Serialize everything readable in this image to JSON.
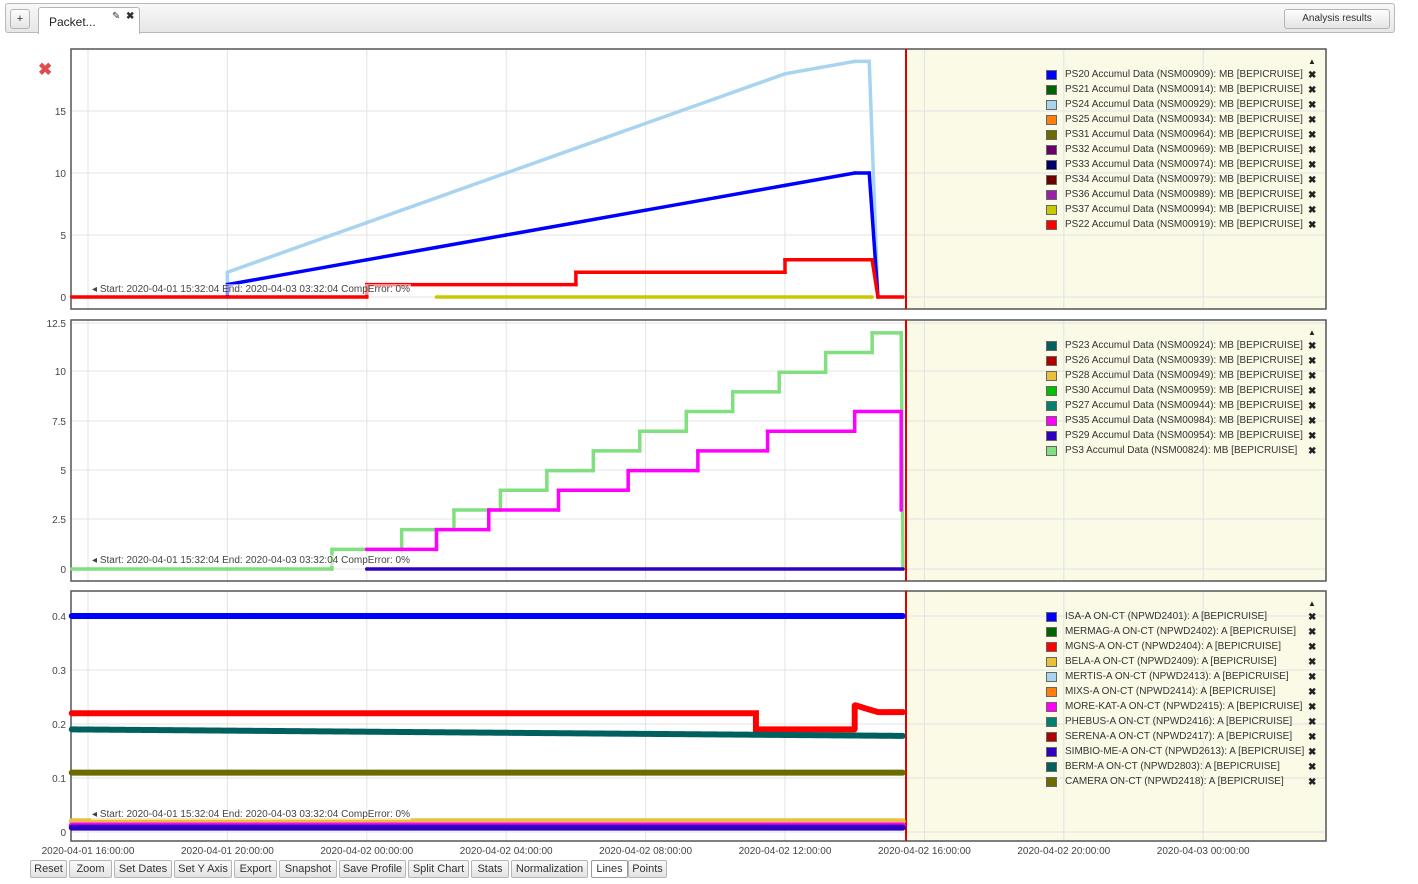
{
  "topbar": {
    "add_label": "+",
    "tab_label": "Packet...",
    "analysis_label": "Analysis results"
  },
  "xaxis_ticks": [
    "2020-04-01 16:00:00",
    "2020-04-01 20:00:00",
    "2020-04-02 00:00:00",
    "2020-04-02 04:00:00",
    "2020-04-02 08:00:00",
    "2020-04-02 12:00:00",
    "2020-04-02 16:00:00",
    "2020-04-02 20:00:00",
    "2020-04-03 00:00:00"
  ],
  "toolbar": {
    "buttons": [
      "Reset",
      "Zoom",
      "Set Dates",
      "Set Y Axis",
      "Export",
      "Snapshot",
      "Save Profile",
      "Split Chart",
      "Stats",
      "Normalization",
      "Lines",
      "Points"
    ]
  },
  "panels": [
    {
      "status": "Start: 2020-04-01 15:32:04 End: 2020-04-03 03:32:04 CompError: 0%",
      "yticks": [
        "0",
        "5",
        "10",
        "15"
      ],
      "legend": [
        {
          "label": "PS20 Accumul Data (NSM00909): MB [BEPICRUISE]",
          "color": "#0000ff"
        },
        {
          "label": "PS21 Accumul Data (NSM00914): MB [BEPICRUISE]",
          "color": "#006400"
        },
        {
          "label": "PS24 Accumul Data (NSM00929): MB [BEPICRUISE]",
          "color": "#a8d4f0"
        },
        {
          "label": "PS25 Accumul Data (NSM00934): MB [BEPICRUISE]",
          "color": "#ff7f0e"
        },
        {
          "label": "PS31 Accumul Data (NSM00964): MB [BEPICRUISE]",
          "color": "#6b6b00"
        },
        {
          "label": "PS32 Accumul Data (NSM00969): MB [BEPICRUISE]",
          "color": "#6b006b"
        },
        {
          "label": "PS33 Accumul Data (NSM00974): MB [BEPICRUISE]",
          "color": "#00006b"
        },
        {
          "label": "PS34 Accumul Data (NSM00979): MB [BEPICRUISE]",
          "color": "#6b0000"
        },
        {
          "label": "PS36 Accumul Data (NSM00989): MB [BEPICRUISE]",
          "color": "#9b1fa8"
        },
        {
          "label": "PS37 Accumul Data (NSM00994): MB [BEPICRUISE]",
          "color": "#c8c800"
        },
        {
          "label": "PS22 Accumul Data (NSM00919): MB [BEPICRUISE]",
          "color": "#ff0000"
        }
      ]
    },
    {
      "status": "Start: 2020-04-01 15:32:04 End: 2020-04-03 03:32:04 CompError: 0%",
      "yticks": [
        "0",
        "2.5",
        "5",
        "7.5",
        "10",
        "12.5"
      ],
      "legend": [
        {
          "label": "PS23 Accumul Data (NSM00924): MB [BEPICRUISE]",
          "color": "#006060"
        },
        {
          "label": "PS26 Accumul Data (NSM00939): MB [BEPICRUISE]",
          "color": "#b00000"
        },
        {
          "label": "PS28 Accumul Data (NSM00949): MB [BEPICRUISE]",
          "color": "#e8c040"
        },
        {
          "label": "PS30 Accumul Data (NSM00959): MB [BEPICRUISE]",
          "color": "#00c000"
        },
        {
          "label": "PS27 Accumul Data (NSM00944): MB [BEPICRUISE]",
          "color": "#008070"
        },
        {
          "label": "PS35 Accumul Data (NSM00984): MB [BEPICRUISE]",
          "color": "#ff00ff"
        },
        {
          "label": "PS29 Accumul Data (NSM00954): MB [BEPICRUISE]",
          "color": "#3000c0"
        },
        {
          "label": "PS3 Accumul Data (NSM00824): MB [BEPICRUISE]",
          "color": "#80e080"
        }
      ]
    },
    {
      "status": "Start: 2020-04-01 15:32:04 End: 2020-04-03 03:32:04 CompError: 0%",
      "yticks": [
        "0",
        "0.1",
        "0.2",
        "0.3",
        "0.4"
      ],
      "legend": [
        {
          "label": "ISA-A ON-CT (NPWD2401): A [BEPICRUISE]",
          "color": "#0000ff"
        },
        {
          "label": "MERMAG-A ON-CT (NPWD2402): A [BEPICRUISE]",
          "color": "#006400"
        },
        {
          "label": "MGNS-A ON-CT (NPWD2404): A [BEPICRUISE]",
          "color": "#ff0000"
        },
        {
          "label": "BELA-A ON-CT (NPWD2409): A [BEPICRUISE]",
          "color": "#e8c040"
        },
        {
          "label": "MERTIS-A ON-CT (NPWD2413): A [BEPICRUISE]",
          "color": "#a8d4f0"
        },
        {
          "label": "MIXS-A ON-CT (NPWD2414): A [BEPICRUISE]",
          "color": "#ff7f0e"
        },
        {
          "label": "MORE-KAT-A ON-CT (NPWD2415): A [BEPICRUISE]",
          "color": "#ff00ff"
        },
        {
          "label": "PHEBUS-A ON-CT (NPWD2416): A [BEPICRUISE]",
          "color": "#008070"
        },
        {
          "label": "SERENA-A ON-CT (NPWD2417): A [BEPICRUISE]",
          "color": "#b00000"
        },
        {
          "label": "SIMBIO-ME-A ON-CT (NPWD2613): A [BEPICRUISE]",
          "color": "#3000c0"
        },
        {
          "label": "BERM-A ON-CT (NPWD2803): A [BEPICRUISE]",
          "color": "#006060"
        },
        {
          "label": "CAMERA ON-CT (NPWD2418): A [BEPICRUISE]",
          "color": "#6b6b00"
        }
      ]
    }
  ],
  "chart_data": [
    {
      "type": "line",
      "ylim": [
        0,
        19
      ],
      "series": [
        {
          "name": "PS24 Accumul Data (NSM00929): MB [BEPICRUISE]",
          "color": "#a8d4f0",
          "points": [
            [
              "2020-04-01 20:00",
              0
            ],
            [
              "2020-04-01 20:00",
              2
            ],
            [
              "2020-04-01 21:00",
              3
            ],
            [
              "2020-04-01 22:00",
              4
            ],
            [
              "2020-04-01 23:00",
              5
            ],
            [
              "2020-04-02 00:00",
              6
            ],
            [
              "2020-04-02 01:00",
              7
            ],
            [
              "2020-04-02 02:00",
              8
            ],
            [
              "2020-04-02 03:00",
              9
            ],
            [
              "2020-04-02 04:00",
              10
            ],
            [
              "2020-04-02 05:00",
              11
            ],
            [
              "2020-04-02 06:00",
              12
            ],
            [
              "2020-04-02 07:00",
              13
            ],
            [
              "2020-04-02 08:00",
              14
            ],
            [
              "2020-04-02 09:00",
              15
            ],
            [
              "2020-04-02 10:00",
              16
            ],
            [
              "2020-04-02 11:00",
              17
            ],
            [
              "2020-04-02 12:00",
              18
            ],
            [
              "2020-04-02 14:00",
              19
            ],
            [
              "2020-04-02 14:25",
              19
            ],
            [
              "2020-04-02 14:40",
              0
            ]
          ]
        },
        {
          "name": "PS20 Accumul Data (NSM00909): MB [BEPICRUISE]",
          "color": "#0000ff",
          "points": [
            [
              "2020-04-01 20:00",
              0
            ],
            [
              "2020-04-01 20:00",
              1
            ],
            [
              "2020-04-01 22:00",
              2
            ],
            [
              "2020-04-02 00:00",
              3
            ],
            [
              "2020-04-02 02:00",
              4
            ],
            [
              "2020-04-02 04:00",
              5
            ],
            [
              "2020-04-02 06:00",
              6
            ],
            [
              "2020-04-02 08:00",
              7
            ],
            [
              "2020-04-02 10:00",
              8
            ],
            [
              "2020-04-02 12:00",
              9
            ],
            [
              "2020-04-02 14:00",
              10
            ],
            [
              "2020-04-02 14:25",
              10
            ],
            [
              "2020-04-02 14:40",
              0
            ]
          ]
        },
        {
          "name": "PS22 Accumul Data (NSM00919): MB [BEPICRUISE]",
          "color": "#ff0000",
          "points": [
            [
              "2020-04-01 15:32",
              0
            ],
            [
              "2020-04-02 00:00",
              0
            ],
            [
              "2020-04-02 00:00",
              1
            ],
            [
              "2020-04-02 06:00",
              1
            ],
            [
              "2020-04-02 06:00",
              2
            ],
            [
              "2020-04-02 12:00",
              2
            ],
            [
              "2020-04-02 12:00",
              3
            ],
            [
              "2020-04-02 14:30",
              3
            ],
            [
              "2020-04-02 14:40",
              0
            ],
            [
              "2020-04-02 16:00",
              0
            ]
          ]
        },
        {
          "name": "PS37 Accumul Data (NSM00994): MB [BEPICRUISE]",
          "color": "#c8c800",
          "points": [
            [
              "2020-04-02 02:00",
              0
            ],
            [
              "2020-04-02 14:30",
              0
            ]
          ]
        }
      ]
    },
    {
      "type": "line",
      "ylim": [
        0,
        12.5
      ],
      "series": [
        {
          "name": "PS3 Accumul Data (NSM00824): MB [BEPICRUISE]",
          "color": "#80e080",
          "points": [
            [
              "2020-04-01 15:32",
              0
            ],
            [
              "2020-04-01 23:00",
              0
            ],
            [
              "2020-04-01 23:00",
              1
            ],
            [
              "2020-04-02 01:00",
              1
            ],
            [
              "2020-04-02 01:00",
              2
            ],
            [
              "2020-04-02 02:30",
              2
            ],
            [
              "2020-04-02 02:30",
              3
            ],
            [
              "2020-04-02 03:50",
              3
            ],
            [
              "2020-04-02 03:50",
              4
            ],
            [
              "2020-04-02 05:10",
              4
            ],
            [
              "2020-04-02 05:10",
              5
            ],
            [
              "2020-04-02 06:30",
              5
            ],
            [
              "2020-04-02 06:30",
              6
            ],
            [
              "2020-04-02 07:50",
              6
            ],
            [
              "2020-04-02 07:50",
              7
            ],
            [
              "2020-04-02 09:10",
              7
            ],
            [
              "2020-04-02 09:10",
              8
            ],
            [
              "2020-04-02 10:30",
              8
            ],
            [
              "2020-04-02 10:30",
              9
            ],
            [
              "2020-04-02 11:50",
              9
            ],
            [
              "2020-04-02 11:50",
              10
            ],
            [
              "2020-04-02 13:10",
              10
            ],
            [
              "2020-04-02 13:10",
              11
            ],
            [
              "2020-04-02 14:30",
              11
            ],
            [
              "2020-04-02 14:30",
              12
            ],
            [
              "2020-04-02 15:20",
              12
            ],
            [
              "2020-04-02 15:30",
              0
            ],
            [
              "2020-04-02 16:00",
              0
            ]
          ]
        },
        {
          "name": "PS35 Accumul Data (NSM00984): MB [BEPICRUISE]",
          "color": "#ff00ff",
          "points": [
            [
              "2020-04-02 00:00",
              1
            ],
            [
              "2020-04-02 02:00",
              1
            ],
            [
              "2020-04-02 02:00",
              2
            ],
            [
              "2020-04-02 03:30",
              2
            ],
            [
              "2020-04-02 03:30",
              3
            ],
            [
              "2020-04-02 05:30",
              3
            ],
            [
              "2020-04-02 05:30",
              4
            ],
            [
              "2020-04-02 07:30",
              4
            ],
            [
              "2020-04-02 07:30",
              5
            ],
            [
              "2020-04-02 09:30",
              5
            ],
            [
              "2020-04-02 09:30",
              6
            ],
            [
              "2020-04-02 11:30",
              6
            ],
            [
              "2020-04-02 11:30",
              7
            ],
            [
              "2020-04-02 14:00",
              7
            ],
            [
              "2020-04-02 14:00",
              8
            ],
            [
              "2020-04-02 15:20",
              8
            ],
            [
              "2020-04-02 15:20",
              3
            ]
          ]
        },
        {
          "name": "PS29 Accumul Data (NSM00954): MB [BEPICRUISE]",
          "color": "#3000c0",
          "points": [
            [
              "2020-04-02 00:00",
              0
            ],
            [
              "2020-04-02 15:30",
              0
            ]
          ]
        }
      ]
    },
    {
      "type": "scatter",
      "ylim": [
        0,
        0.4
      ],
      "series": [
        {
          "name": "ISA-A ON-CT (NPWD2401): A [BEPICRUISE]",
          "color": "#0000ff",
          "points": [
            [
              "2020-04-01 15:32",
              0.4
            ],
            [
              "2020-04-02 15:30",
              0.4
            ]
          ]
        },
        {
          "name": "MGNS-A ON-CT (NPWD2404): A [BEPICRUISE]",
          "color": "#ff0000",
          "points": [
            [
              "2020-04-01 15:32",
              0.22
            ],
            [
              "2020-04-02 11:10",
              0.22
            ],
            [
              "2020-04-02 11:10",
              0.19
            ],
            [
              "2020-04-02 14:00",
              0.19
            ],
            [
              "2020-04-02 14:00",
              0.235
            ],
            [
              "2020-04-02 14:40",
              0.222
            ],
            [
              "2020-04-02 15:30",
              0.222
            ]
          ]
        },
        {
          "name": "BERM-A ON-CT (NPWD2803): A [BEPICRUISE]",
          "color": "#006060",
          "points": [
            [
              "2020-04-01 15:32",
              0.19
            ],
            [
              "2020-04-02 15:30",
              0.178
            ]
          ]
        },
        {
          "name": "CAMERA ON-CT (NPWD2418): A [BEPICRUISE]",
          "color": "#6b6b00",
          "points": [
            [
              "2020-04-01 15:32",
              0.11
            ],
            [
              "2020-04-02 15:30",
              0.11
            ]
          ]
        },
        {
          "name": "BELA-A ON-CT (NPWD2409): A [BEPICRUISE]",
          "color": "#e8c040",
          "points": [
            [
              "2020-04-01 15:32",
              0.02
            ],
            [
              "2020-04-02 15:30",
              0.02
            ]
          ]
        },
        {
          "name": "MORE-KAT-A ON-CT (NPWD2415): A [BEPICRUISE]",
          "color": "#ff00ff",
          "points": [
            [
              "2020-04-01 15:32",
              0.012
            ],
            [
              "2020-04-02 15:30",
              0.012
            ]
          ]
        },
        {
          "name": "SIMBIO-ME-A ON-CT (NPWD2613): A [BEPICRUISE]",
          "color": "#3000c0",
          "points": [
            [
              "2020-04-01 15:32",
              0.008
            ],
            [
              "2020-04-02 15:30",
              0.008
            ]
          ]
        }
      ]
    }
  ]
}
